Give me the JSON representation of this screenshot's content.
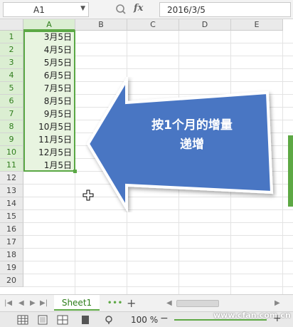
{
  "formula_bar": {
    "cell_ref": "A1",
    "fx_label": "fx",
    "formula_value": "2016/3/5"
  },
  "columns": [
    "A",
    "B",
    "C",
    "D",
    "E"
  ],
  "rows": [
    "1",
    "2",
    "3",
    "4",
    "5",
    "6",
    "7",
    "8",
    "9",
    "10",
    "11",
    "12",
    "13",
    "14",
    "15",
    "16",
    "17",
    "18",
    "19",
    "20"
  ],
  "column_a_values": [
    "3月5日",
    "4月5日",
    "5月5日",
    "6月5日",
    "7月5日",
    "8月5日",
    "9月5日",
    "10月5日",
    "11月5日",
    "12月5日",
    "1月5日"
  ],
  "callout": {
    "line1": "按1个月的增量",
    "line2": "递增",
    "fill_color": "#4a76c3"
  },
  "sheet_tabs": {
    "active": "Sheet1"
  },
  "status_bar": {
    "zoom": "100 %",
    "zoom_minus": "−",
    "zoom_plus": "+"
  },
  "watermark": "www.cfan.com.cn",
  "colors": {
    "accent": "#5da844",
    "selection_fill": "#e8f4e0"
  }
}
